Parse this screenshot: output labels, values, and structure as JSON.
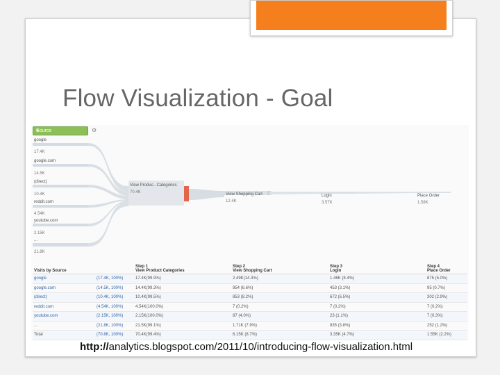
{
  "slide": {
    "title": "Flow Visualization - Goal",
    "url_bold": "http://",
    "url_rest": "analytics.blogspot.com/2011/10/introducing-flow-visualization.html",
    "accent_color": "#f57f1c"
  },
  "flow": {
    "dimension_select": "Source",
    "settings_icon": "gear-icon",
    "sources": [
      {
        "name": "google",
        "value": "17.4K"
      },
      {
        "name": "google.com",
        "value": "14.5K"
      },
      {
        "name": "(direct)",
        "value": "10.4K"
      },
      {
        "name": "reddit.com",
        "value": "4.54K"
      },
      {
        "name": "youtube.com",
        "value": "2.15K"
      },
      {
        "name": "...",
        "value": "21.8K"
      }
    ],
    "steps": [
      {
        "name": "View Produc...Categories",
        "value": "70.4K"
      },
      {
        "name": "View Shopping Cart",
        "value": "12.4K"
      },
      {
        "name": "Login",
        "value": "3.57K"
      },
      {
        "name": "Place Order",
        "value": "1.58K"
      }
    ]
  },
  "table": {
    "headers": [
      {
        "line1": "Visits by Source",
        "line2": ""
      },
      {
        "line1": "",
        "line2": ""
      },
      {
        "line1": "Step 1",
        "line2": "View Product Categories"
      },
      {
        "line1": "Step 2",
        "line2": "View Shopping Cart"
      },
      {
        "line1": "Step 3",
        "line2": "Login"
      },
      {
        "line1": "Step 4",
        "line2": "Place Order"
      }
    ],
    "rows": [
      {
        "source": "google",
        "visits": "(17.4K, 100%)",
        "s1": "17.4K(99.9%)",
        "s2": "2.49K(14.3%)",
        "s3": "1.46K (8.4%)",
        "s4": "875 (5.0%)"
      },
      {
        "source": "google.com",
        "visits": "(14.5K, 100%)",
        "s1": "14.4K(99.3%)",
        "s2": "954 (6.6%)",
        "s3": "453 (3.1%)",
        "s4": "95 (0.7%)"
      },
      {
        "source": "(direct)",
        "visits": "(10.4K, 100%)",
        "s1": "10.4K(99.5%)",
        "s2": "853 (8.2%)",
        "s3": "672 (6.5%)",
        "s4": "302 (2.9%)"
      },
      {
        "source": "reddit.com",
        "visits": "(4.54K, 100%)",
        "s1": "4.54K(100.0%)",
        "s2": "7 (0.2%)",
        "s3": "7 (0.2%)",
        "s4": "7 (0.2%)"
      },
      {
        "source": "youtube.com",
        "visits": "(2.15K, 100%)",
        "s1": "2.15K(100.0%)",
        "s2": "87 (4.0%)",
        "s3": "23 (1.1%)",
        "s4": "7 (0.3%)"
      },
      {
        "source": "...",
        "visits": "(21.8K, 100%)",
        "s1": "21.5K(99.1%)",
        "s2": "1.71K (7.9%)",
        "s3": "835 (3.8%)",
        "s4": "252 (1.2%)"
      },
      {
        "source": "Total",
        "visits": "(70.8K, 100%)",
        "s1": "70.4K(99.4%)",
        "s2": "6.15K (8.7%)",
        "s3": "3.35K (4.7%)",
        "s4": "1.55K (2.2%)"
      }
    ]
  }
}
